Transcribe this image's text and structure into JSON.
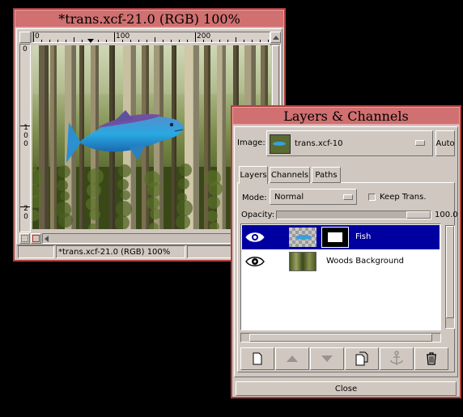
{
  "image_window": {
    "title": "*trans.xcf-21.0 (RGB) 100%",
    "status": "*trans.xcf-21.0 (RGB) 100%",
    "ruler_h": [
      "0",
      "100",
      "200"
    ],
    "ruler_v": [
      "0",
      "1 0 0",
      "2 0"
    ]
  },
  "layers_window": {
    "title": "Layers & Channels",
    "image_label": "Image:",
    "image_value": "trans.xcf-10",
    "auto_label": "Auto",
    "tabs": [
      "Layers",
      "Channels",
      "Paths"
    ],
    "mode_label": "Mode:",
    "mode_value": "Normal",
    "keep_trans_label": "Keep Trans.",
    "opacity_label": "Opacity:",
    "opacity_value": "100.0",
    "layers": [
      {
        "name": "Fish",
        "selected": true
      },
      {
        "name": "Woods Background",
        "selected": false
      }
    ],
    "close_label": "Close"
  },
  "colors": {
    "title_bar": "#d07070",
    "selection": "#0000a0",
    "window_bg": "#d0c8c0"
  }
}
